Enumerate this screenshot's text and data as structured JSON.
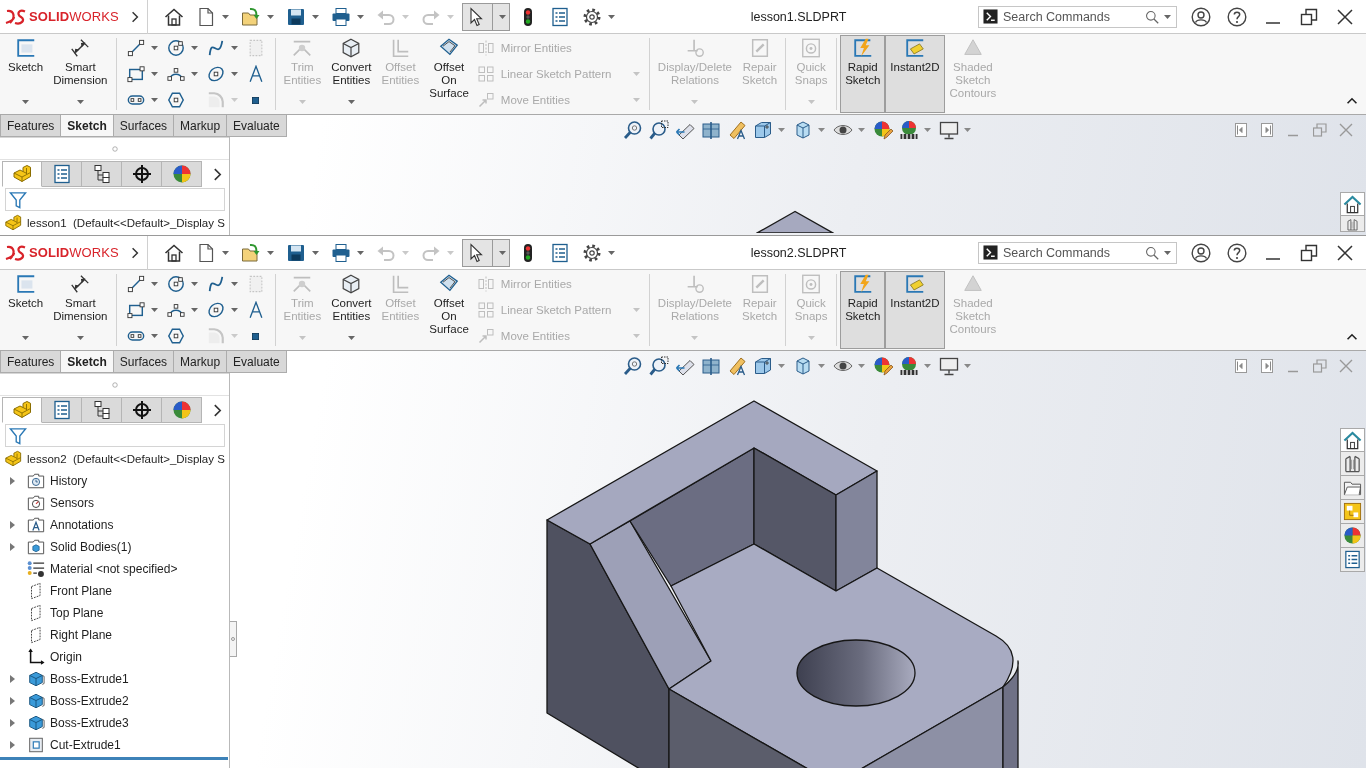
{
  "windows": [
    {
      "logo": "**SOLID**WORKS",
      "title": "lesson1.SLDPRT",
      "quick_access": [
        {
          "disabled": false,
          "selected": false
        },
        {
          "disabled": false,
          "selected": false
        },
        {
          "disabled": false,
          "selected": false
        },
        {
          "disabled": false,
          "selected": false
        },
        {
          "disabled": false,
          "selected": false
        },
        {
          "disabled": true,
          "selected": false
        },
        {
          "disabled": true,
          "selected": false
        },
        {
          "disabled": false,
          "selected": true
        },
        {
          "disabled": false,
          "selected": false
        },
        {
          "disabled": false,
          "selected": false
        },
        {
          "disabled": false,
          "selected": false
        }
      ],
      "search": {
        "placeholder": "Search Commands"
      },
      "ribbon": [
        {
          "kind": "large",
          "label": "Sketch",
          "disabled": false,
          "on": false,
          "menu": true
        },
        {
          "kind": "large",
          "label": "Smart Dimension",
          "disabled": false,
          "on": false,
          "menu": true
        },
        {
          "kind": "separator"
        },
        {
          "kind": "grid",
          "tools": [
            {
              "disabled": false,
              "menu": true
            },
            {
              "disabled": false,
              "menu": true
            },
            {
              "disabled": false,
              "menu": true
            },
            {
              "disabled": true,
              "menu": false
            },
            {
              "disabled": false,
              "menu": true
            },
            {
              "disabled": false,
              "menu": true
            },
            {
              "disabled": false,
              "menu": true
            },
            {
              "disabled": false,
              "menu": false
            },
            {
              "disabled": false,
              "menu": true
            },
            {
              "disabled": false,
              "menu": false
            },
            {
              "disabled": true,
              "menu": true
            },
            {
              "disabled": false,
              "menu": false
            }
          ]
        },
        {
          "kind": "separator"
        },
        {
          "kind": "large",
          "label": "Trim Entities",
          "disabled": true,
          "on": false,
          "menu": true
        },
        {
          "kind": "large",
          "label": "Convert Entities",
          "disabled": false,
          "on": false,
          "menu": true
        },
        {
          "kind": "large",
          "label": "Offset Entities",
          "disabled": true,
          "on": false,
          "menu": false
        },
        {
          "kind": "large",
          "label": "Offset On Surface",
          "disabled": false,
          "on": false,
          "menu": false
        },
        {
          "kind": "rows",
          "tools": [
            {
              "label": "Mirror Entities",
              "disabled": true,
              "menu": false
            },
            {
              "label": "Linear Sketch Pattern",
              "disabled": true,
              "menu": true
            },
            {
              "label": "Move Entities",
              "disabled": true,
              "menu": true
            }
          ]
        },
        {
          "kind": "separator"
        },
        {
          "kind": "large",
          "label": "Display/Delete Relations",
          "disabled": true,
          "on": false,
          "menu": true
        },
        {
          "kind": "large",
          "label": "Repair Sketch",
          "disabled": true,
          "on": false,
          "menu": false
        },
        {
          "kind": "separator"
        },
        {
          "kind": "large",
          "label": "Quick Snaps",
          "disabled": true,
          "on": false,
          "menu": true
        },
        {
          "kind": "separator"
        },
        {
          "kind": "large",
          "label": "Rapid Sketch",
          "disabled": false,
          "on": true,
          "menu": false
        },
        {
          "kind": "large",
          "label": "Instant2D",
          "disabled": false,
          "on": true,
          "menu": false
        },
        {
          "kind": "large",
          "label": "Shaded Sketch Contours",
          "disabled": true,
          "on": false,
          "menu": false
        }
      ],
      "tabs": [
        {
          "label": "Features",
          "selected": false
        },
        {
          "label": "Sketch",
          "selected": true
        },
        {
          "label": "Surfaces",
          "selected": false
        },
        {
          "label": "Markup",
          "selected": false
        },
        {
          "label": "Evaluate",
          "selected": false
        }
      ],
      "panel_tabs": [
        {
          "selected": true
        },
        {
          "selected": false
        },
        {
          "selected": false
        },
        {
          "selected": false
        },
        {
          "selected": false
        }
      ],
      "tree": {
        "root": "lesson1  (Default<<Default>_Display S"
      },
      "task_pane": [
        {
          "selected": true
        },
        {
          "selected": false
        }
      ]
    },
    {
      "logo": "**SOLID**WORKS",
      "title": "lesson2.SLDPRT",
      "quick_access": [
        {
          "disabled": false,
          "selected": false
        },
        {
          "disabled": false,
          "selected": false
        },
        {
          "disabled": false,
          "selected": false
        },
        {
          "disabled": false,
          "selected": false
        },
        {
          "disabled": false,
          "selected": false
        },
        {
          "disabled": true,
          "selected": false
        },
        {
          "disabled": true,
          "selected": false
        },
        {
          "disabled": false,
          "selected": true
        },
        {
          "disabled": false,
          "selected": false
        },
        {
          "disabled": false,
          "selected": false
        },
        {
          "disabled": false,
          "selected": false
        }
      ],
      "search": {
        "placeholder": "Search Commands"
      },
      "ribbon": [
        {
          "kind": "large",
          "label": "Sketch",
          "disabled": false,
          "on": false,
          "menu": true
        },
        {
          "kind": "large",
          "label": "Smart Dimension",
          "disabled": false,
          "on": false,
          "menu": true
        },
        {
          "kind": "separator"
        },
        {
          "kind": "grid",
          "tools": [
            {
              "disabled": false,
              "menu": true
            },
            {
              "disabled": false,
              "menu": true
            },
            {
              "disabled": false,
              "menu": true
            },
            {
              "disabled": true,
              "menu": false
            },
            {
              "disabled": false,
              "menu": true
            },
            {
              "disabled": false,
              "menu": true
            },
            {
              "disabled": false,
              "menu": true
            },
            {
              "disabled": false,
              "menu": false
            },
            {
              "disabled": false,
              "menu": true
            },
            {
              "disabled": false,
              "menu": false
            },
            {
              "disabled": true,
              "menu": true
            },
            {
              "disabled": false,
              "menu": false
            }
          ]
        },
        {
          "kind": "separator"
        },
        {
          "kind": "large",
          "label": "Trim Entities",
          "disabled": true,
          "on": false,
          "menu": true
        },
        {
          "kind": "large",
          "label": "Convert Entities",
          "disabled": false,
          "on": false,
          "menu": true
        },
        {
          "kind": "large",
          "label": "Offset Entities",
          "disabled": true,
          "on": false,
          "menu": false
        },
        {
          "kind": "large",
          "label": "Offset On Surface",
          "disabled": false,
          "on": false,
          "menu": false
        },
        {
          "kind": "rows",
          "tools": [
            {
              "label": "Mirror Entities",
              "disabled": true,
              "menu": false
            },
            {
              "label": "Linear Sketch Pattern",
              "disabled": true,
              "menu": true
            },
            {
              "label": "Move Entities",
              "disabled": true,
              "menu": true
            }
          ]
        },
        {
          "kind": "separator"
        },
        {
          "kind": "large",
          "label": "Display/Delete Relations",
          "disabled": true,
          "on": false,
          "menu": true
        },
        {
          "kind": "large",
          "label": "Repair Sketch",
          "disabled": true,
          "on": false,
          "menu": false
        },
        {
          "kind": "separator"
        },
        {
          "kind": "large",
          "label": "Quick Snaps",
          "disabled": true,
          "on": false,
          "menu": true
        },
        {
          "kind": "separator"
        },
        {
          "kind": "large",
          "label": "Rapid Sketch",
          "disabled": false,
          "on": true,
          "menu": false
        },
        {
          "kind": "large",
          "label": "Instant2D",
          "disabled": false,
          "on": true,
          "menu": false
        },
        {
          "kind": "large",
          "label": "Shaded Sketch Contours",
          "disabled": true,
          "on": false,
          "menu": false
        }
      ],
      "tabs": [
        {
          "label": "Features",
          "selected": false
        },
        {
          "label": "Sketch",
          "selected": true
        },
        {
          "label": "Surfaces",
          "selected": false
        },
        {
          "label": "Markup",
          "selected": false
        },
        {
          "label": "Evaluate",
          "selected": false
        }
      ],
      "panel_tabs": [
        {
          "selected": true
        },
        {
          "selected": false
        },
        {
          "selected": false
        },
        {
          "selected": false
        },
        {
          "selected": false
        }
      ],
      "tree": {
        "root": "lesson2  (Default<<Default>_Display S",
        "items": [
          {
            "label": "History",
            "kind": "history",
            "collapsed": true
          },
          {
            "label": "Sensors",
            "kind": "sensors",
            "collapsed": false
          },
          {
            "label": "Annotations",
            "kind": "annotations",
            "collapsed": true
          },
          {
            "label": "Solid Bodies(1)",
            "kind": "bodies",
            "collapsed": true
          },
          {
            "label": "Material <not specified>",
            "kind": "material",
            "collapsed": false
          },
          {
            "label": "Front Plane",
            "kind": "plane",
            "collapsed": false
          },
          {
            "label": "Top Plane",
            "kind": "plane",
            "collapsed": false
          },
          {
            "label": "Right Plane",
            "kind": "plane",
            "collapsed": false
          },
          {
            "label": "Origin",
            "kind": "origin",
            "collapsed": false
          },
          {
            "label": "Boss-Extrude1",
            "kind": "boss",
            "collapsed": true
          },
          {
            "label": "Boss-Extrude2",
            "kind": "boss",
            "collapsed": true
          },
          {
            "label": "Boss-Extrude3",
            "kind": "boss",
            "collapsed": true
          },
          {
            "label": "Cut-Extrude1",
            "kind": "cut",
            "collapsed": true
          }
        ]
      },
      "task_pane": [
        {
          "selected": true
        },
        {
          "selected": false
        },
        {
          "selected": false
        },
        {
          "selected": false
        },
        {
          "selected": false
        },
        {
          "selected": false
        }
      ]
    }
  ]
}
